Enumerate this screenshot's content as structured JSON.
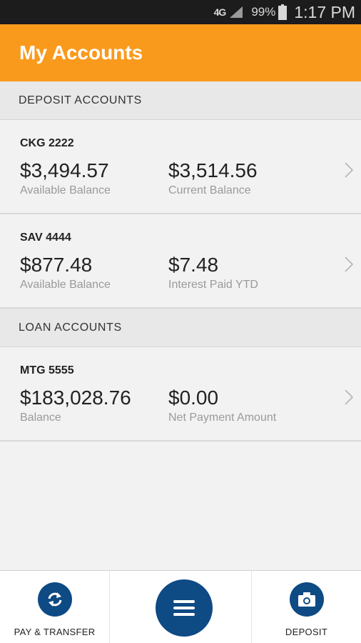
{
  "status_bar": {
    "network": "4G",
    "battery_percent": "99%",
    "time": "1:17 PM",
    "signal_icon": "signal-icon",
    "battery_icon": "battery-icon"
  },
  "header": {
    "title": "My Accounts",
    "color": "#f99a1c"
  },
  "sections": {
    "deposit_title": "DEPOSIT ACCOUNTS",
    "loan_title": "LOAN ACCOUNTS"
  },
  "accounts": [
    {
      "name": "CKG 2222",
      "primary_amount": "$3,494.57",
      "primary_label": "Available Balance",
      "secondary_amount": "$3,514.56",
      "secondary_label": "Current Balance"
    },
    {
      "name": "SAV 4444",
      "primary_amount": "$877.48",
      "primary_label": "Available Balance",
      "secondary_amount": "$7.48",
      "secondary_label": "Interest Paid YTD"
    },
    {
      "name": "MTG 5555",
      "primary_amount": "$183,028.76",
      "primary_label": "Balance",
      "secondary_amount": "$0.00",
      "secondary_label": "Net Payment Amount"
    }
  ],
  "bottom_nav": {
    "pay_transfer_label": "PAY & TRANSFER",
    "pay_transfer_icon": "refresh-icon",
    "menu_icon": "menu-icon",
    "deposit_label": "DEPOSIT",
    "deposit_icon": "camera-icon",
    "accent_color": "#0e4a84"
  }
}
